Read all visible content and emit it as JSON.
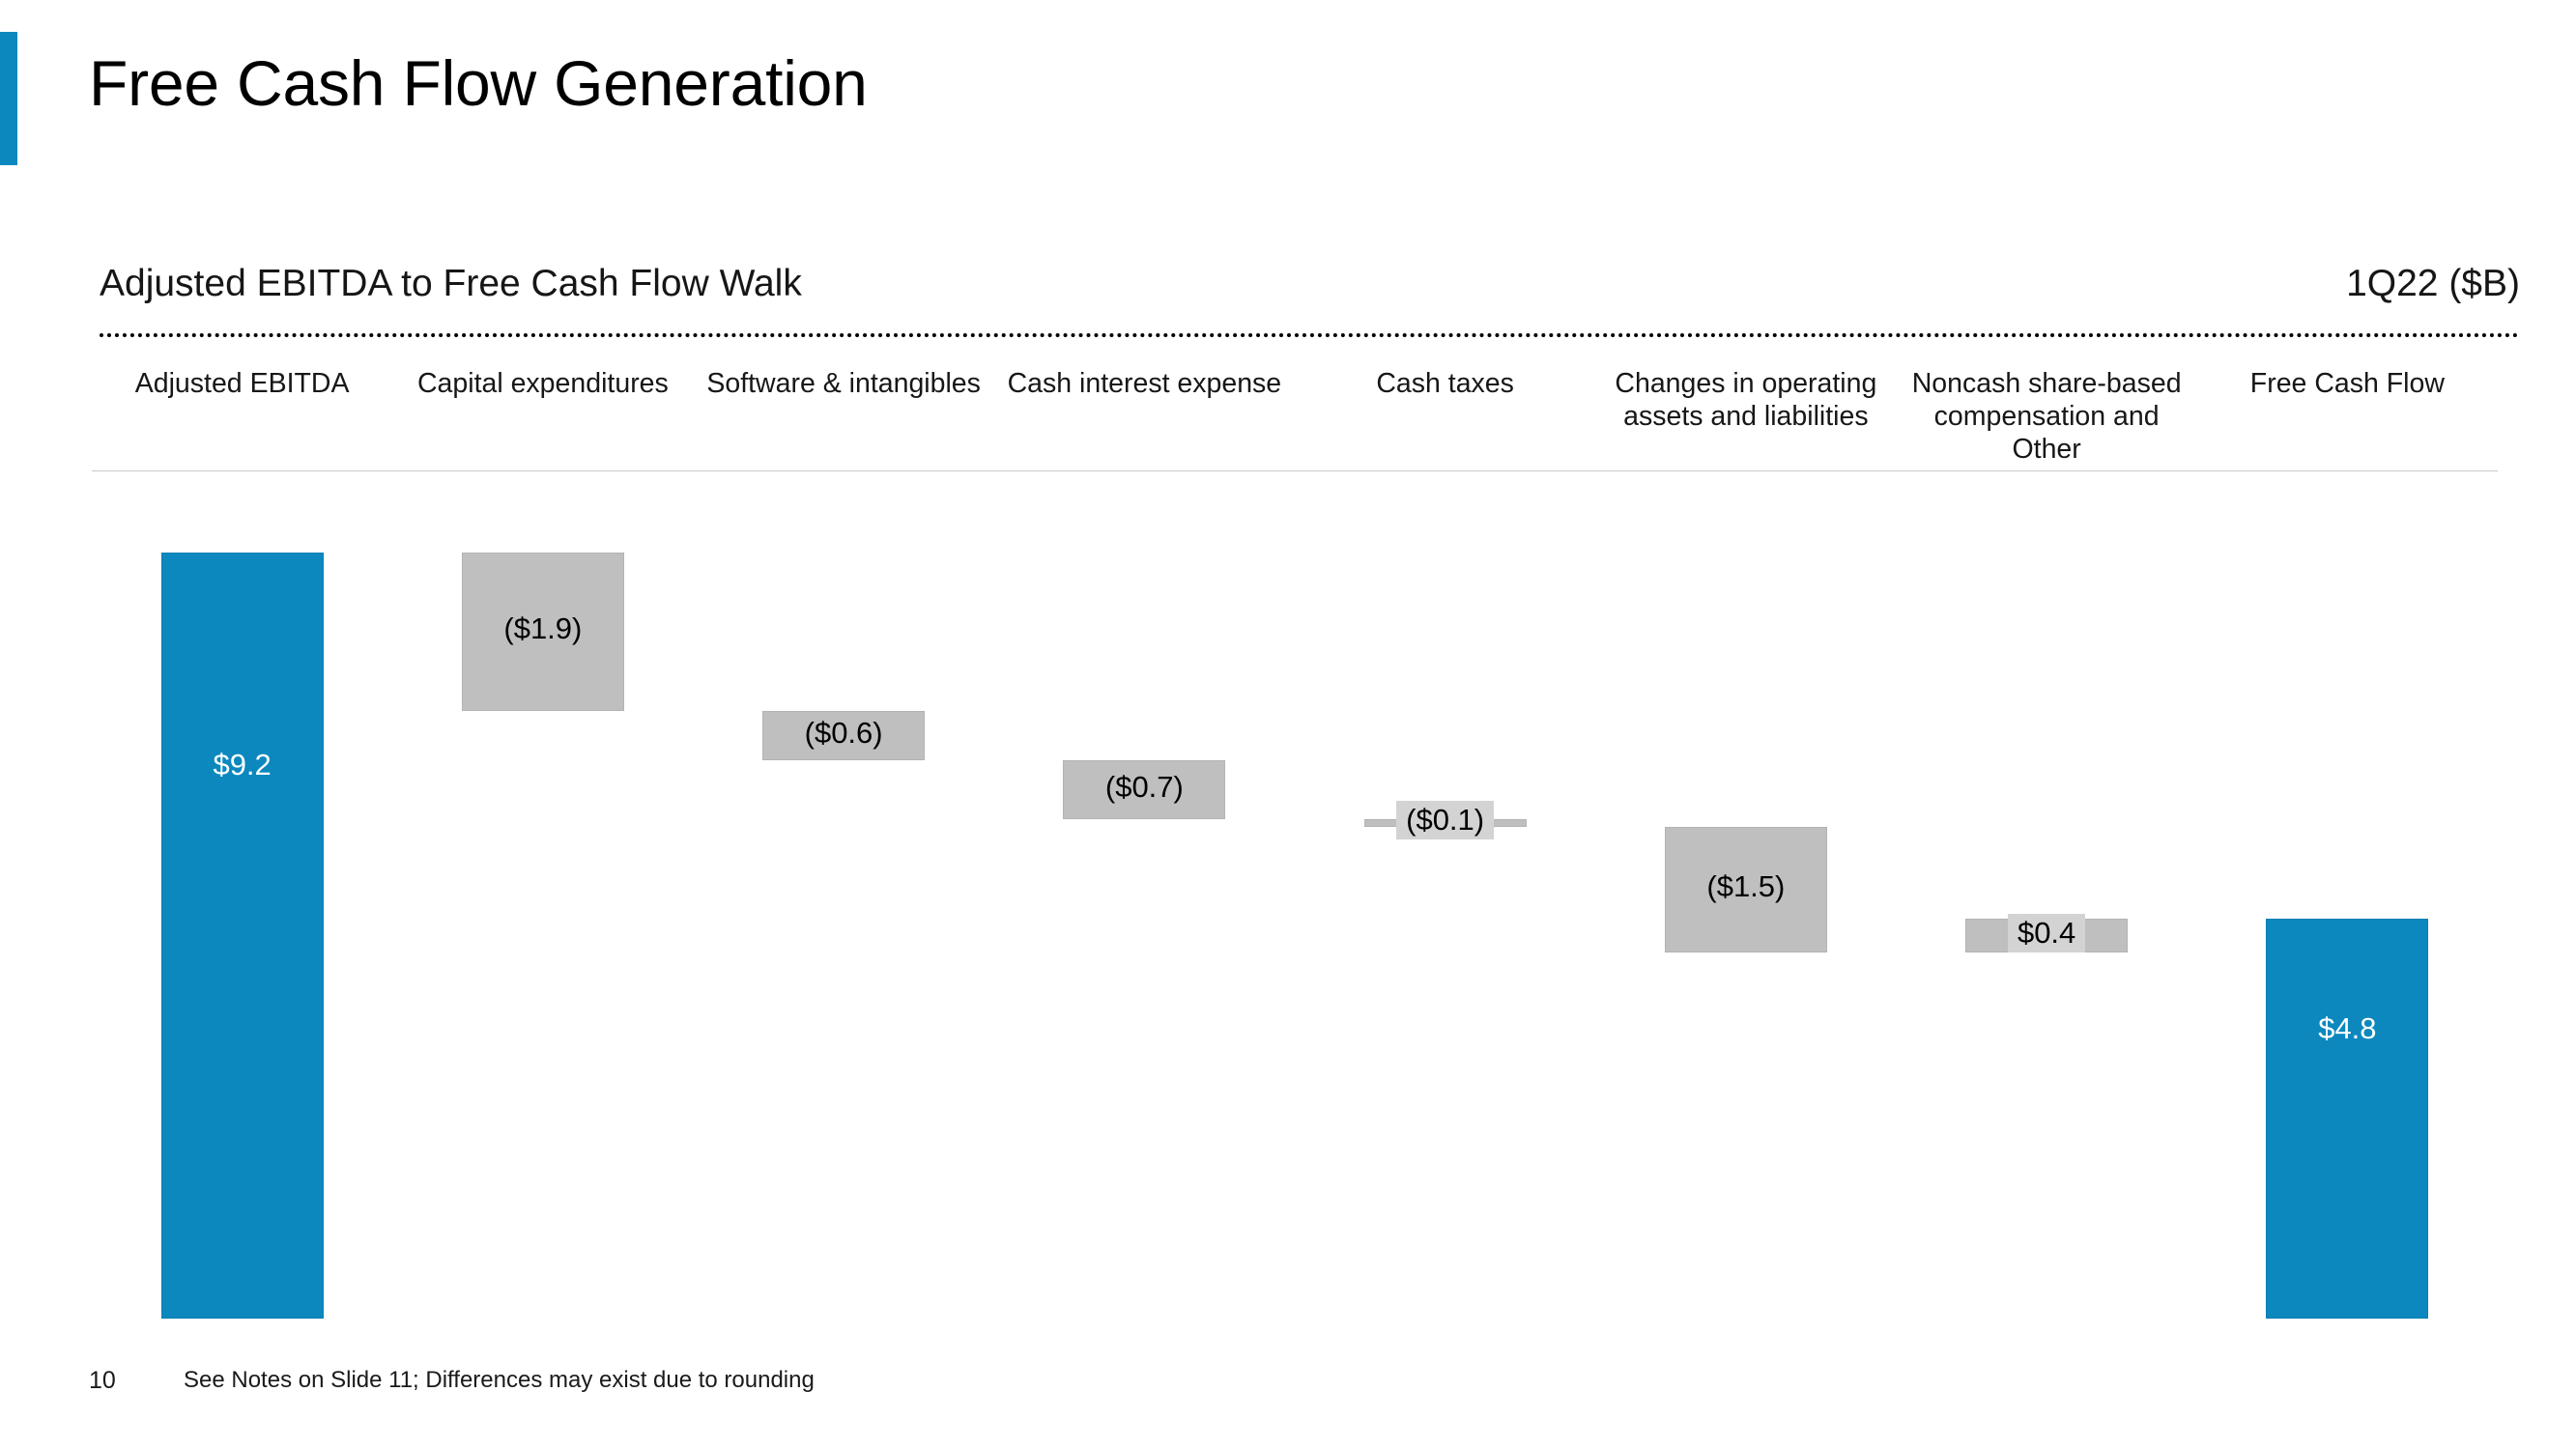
{
  "slide": {
    "title": "Free Cash Flow Generation",
    "page_number": "10",
    "footnote": "See Notes on Slide 11; Differences may exist due to rounding",
    "accent_color": "#0C88BE",
    "bar_gray_color": "#BFBFBF"
  },
  "section": {
    "heading": "Adjusted EBITDA to Free Cash Flow Walk",
    "period": "1Q22 ($B)"
  },
  "chart_data": {
    "type": "bar",
    "subtype": "waterfall",
    "title": "Adjusted EBITDA to Free Cash Flow Walk",
    "subtitle": "1Q22 ($B)",
    "xlabel": "",
    "ylabel": "",
    "units": "$B",
    "grid": false,
    "legend": "none",
    "ylim": [
      0,
      9.2
    ],
    "categories": [
      "Adjusted EBITDA",
      "Capital expenditures",
      "Software & intangibles",
      "Cash interest expense",
      "Cash taxes",
      "Changes in operating assets and liabilities",
      "Noncash share-based compensation and Other",
      "Free Cash Flow"
    ],
    "bars": [
      {
        "label": "Adjusted EBITDA",
        "display": "$9.2",
        "value": 9.2,
        "kind": "total",
        "color": "#0C88BE",
        "base": 0.0,
        "top": 9.2
      },
      {
        "label": "Capital expenditures",
        "display": "($1.9)",
        "value": -1.9,
        "kind": "decrease",
        "color": "#BFBFBF",
        "base": 7.3,
        "top": 9.2
      },
      {
        "label": "Software & intangibles",
        "display": "($0.6)",
        "value": -0.6,
        "kind": "decrease",
        "color": "#BFBFBF",
        "base": 6.7,
        "top": 7.3
      },
      {
        "label": "Cash interest expense",
        "display": "($0.7)",
        "value": -0.7,
        "kind": "decrease",
        "color": "#BFBFBF",
        "base": 6.0,
        "top": 6.7
      },
      {
        "label": "Cash taxes",
        "display": "($0.1)",
        "value": -0.1,
        "kind": "decrease",
        "color": "#BFBFBF",
        "base": 5.9,
        "top": 6.0
      },
      {
        "label": "Changes in operating assets and liabilities",
        "display": "($1.5)",
        "value": -1.5,
        "kind": "decrease",
        "color": "#BFBFBF",
        "base": 4.4,
        "top": 5.9
      },
      {
        "label": "Noncash share-based compensation and Other",
        "display": "$0.4",
        "value": 0.4,
        "kind": "increase",
        "color": "#BFBFBF",
        "base": 4.4,
        "top": 4.8
      },
      {
        "label": "Free Cash Flow",
        "display": "$4.8",
        "value": 4.8,
        "kind": "total",
        "color": "#0C88BE",
        "base": 0.0,
        "top": 4.8
      }
    ]
  }
}
